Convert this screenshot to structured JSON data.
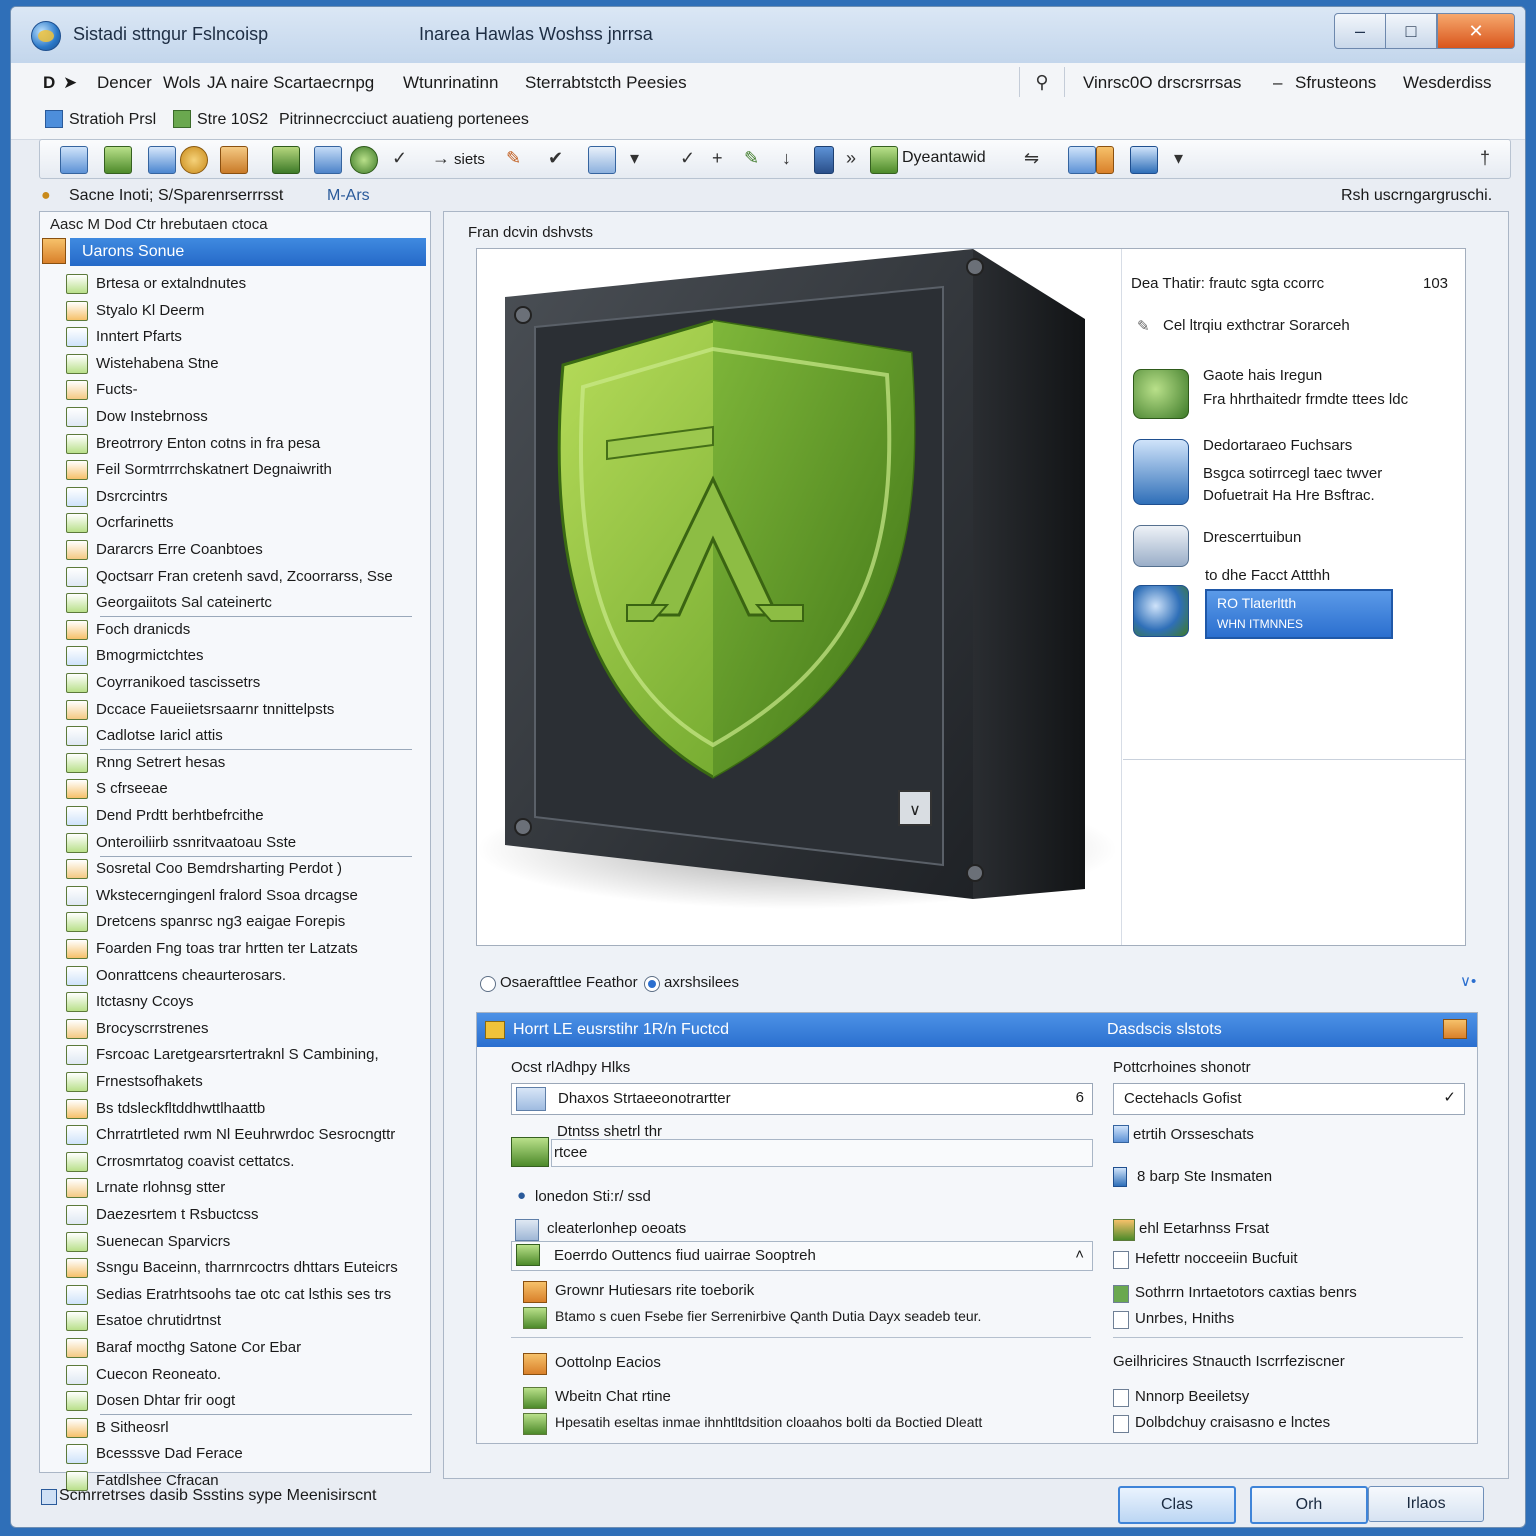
{
  "window": {
    "title": "Sistadi sttngur Fslncoisp",
    "subtitle": "Inarea Hawlas Woshss jnrrsa"
  },
  "menu": {
    "items": [
      "Dencer",
      "Wols",
      "JA naire Scartaecrnpg",
      "Wtunrinatinn",
      "Sterrabtstcth Peesies"
    ],
    "right_items": [
      "Vinrsc0O drscrsrrsas",
      "Sfrusteons",
      "Wesderdiss"
    ]
  },
  "bar2": {
    "item1": "Stratioh Prsl",
    "item2": "Stre 10S2",
    "item3": "Pitrinnecrcciuct auatieng portenees"
  },
  "toolbar": {
    "label_1": "siets",
    "label_2": "Dyeantawid"
  },
  "bar4": {
    "left": "Sacne Inoti; S/Sparenrserrrsst",
    "mid": "M-Ars",
    "right": "Rsh uscrngargruschi."
  },
  "sidebar": {
    "header": "Aasc M Dod Ctr hrebutaen ctoca",
    "selected": "Uarons Sonue",
    "items": [
      "Brtesa or extalndnutes",
      "Styalo Kl Deerm",
      "Inntert Pfarts",
      "Wistehabena Stne",
      "Fucts-",
      "Dow Instebrnoss",
      "Breotrrory Enton cotns in fra pesa",
      "Feil Sormtrrrchskatnert Degnaiwrith",
      "Dsrcrcintrs",
      "Ocrfarinetts",
      "Dararcrs Erre Coanbtoes",
      "Qoctsarr Fran cretenh savd, Zcoorrarss, Sse",
      "Georgaiitots Sal cateinertc",
      "Foch dranicds",
      "Bmogrmictchtes",
      "Coyrranikoed tascissetrs",
      "Dccace Faueiietsrsaarnr tnnittelpsts",
      "Cadlotse Iaricl attis",
      "Rnng Setrert hesas",
      "S cfrseeae",
      "Dend Prdtt berhtbefrcithe",
      "Onteroiliirb ssnritvaatoau Sste",
      "Sosretal Coo Bemdrsharting Perdot )",
      "Wkstecerngingenl fralord Ssoa drcagse",
      "Dretcens spanrsc ng3 eaigae Forepis",
      "Foarden Fng toas trar hrtten ter Latzats",
      "Oonrattcens cheaurterosars.",
      "Itctasny Ccoys",
      "Brocyscrrstrenes",
      "Fsrcoac Laretgearsrtertraknl S Cambining,",
      "Frnestsofhakets",
      "Bs tdsleckfltddhwttlhaattb",
      "Chrratrtleted rwm Nl Eeuhrwrdoc Sesrocngttr",
      "Crrosmrtatog coavist cettatcs.",
      "Lrnate rlohnsg stter",
      "Daezesrtem t Rsbuctcss",
      "Suenecan Sparvicrs",
      "Ssngu Baceinn, tharrnrcoctrs dhttars Euteicrs",
      "Sedias Eratrhtsoohs tae otc cat lsthis ses trs",
      "Esatoe chrutidrtnst",
      "Baraf mocthg Satone Cor Ebar",
      "Cuecon Reoneato.",
      "Dosen Dhtar frir oogt",
      "B Sitheosrl",
      "Bcesssve Dad Ferace",
      "Fatdlshee Cfracan"
    ]
  },
  "preview": {
    "title": "Fran dcvin dshvsts"
  },
  "side_info": {
    "header": "Dea Thatir: frautc sgta ccorrc",
    "count": "103",
    "row1": "Cel ltrqiu exthctrar Sorarceh",
    "row2a": "Gaote hais Iregun",
    "row2b": "Fra hhrthaitedr frmdte ttees ldc",
    "row3a": "Dedortaraeo Fuchsars",
    "row3b": "Bsgca sotirrcegl taec twver",
    "row3c": "Dofuetrait Ha Hre Bsftrac.",
    "row4": "Drescerrtuibun",
    "row5": "to dhe Facct Attthh",
    "btn_line1": "RO Tlaterltth",
    "btn_line2": "WHN ITMNNES"
  },
  "options": {
    "radio1": "Osaerafttlee Feathor",
    "radio2": "axrshsilees"
  },
  "panel": {
    "header_left": "Horrt LE eusrstihr 1R/n Fuctcd",
    "header_right": "Dasdscis slstots",
    "left_label": "Ocst rlAdhpy Hlks",
    "input_value": "Dhaxos Strtaeeonotrartter",
    "input_tail": "6",
    "sub_label": "Dtntss shetrl thr",
    "textbox_value": "rtcee",
    "group_label": "lonedon Sti:r/ ssd",
    "row_a": "cleaterlonhep oeoats",
    "row_b": "Eoerrdo Outtencs fiud uairrae Sooptreh",
    "row_c": "Grownr Hutiesars rite toeborik",
    "row_d": "Btamo s cuen Fsebe fier Serrenirbive Qanth Dutia Dayx seadeb teur.",
    "row_e": "Oottolnp Eacios",
    "row_f": "Wbeitn Chat rtine",
    "row_g": "Hpesatih eseltas inmae ihnhtltdsition cloaahos bolti da Boctied Dleatt",
    "right_label": "Pottcrhoines shonotr",
    "select_value": "Cectehacls Gofist",
    "r1": "etrtih Orsseschats",
    "r2": "8 barp Ste Insmaten",
    "r3": "ehl Eetarhnss Frsat",
    "r4": "Hefettr nocceeiin Bucfuit",
    "r5": "Sothrrn Inrtaetotors caxtias benrs",
    "r6": "Unrbes, Hniths",
    "r7": "Geilhricires Stnaucth Iscrrfeziscner",
    "r8": "Nnnorp Beeiletsy",
    "r9": "Dolbdchuy craisasno e lnctes"
  },
  "buttons": {
    "b1": "Clas",
    "b2": "Orh",
    "b3": "Irlaos"
  },
  "status": {
    "text": "Scmrretrses dasib Ssstins sype Meenisirscnt"
  }
}
